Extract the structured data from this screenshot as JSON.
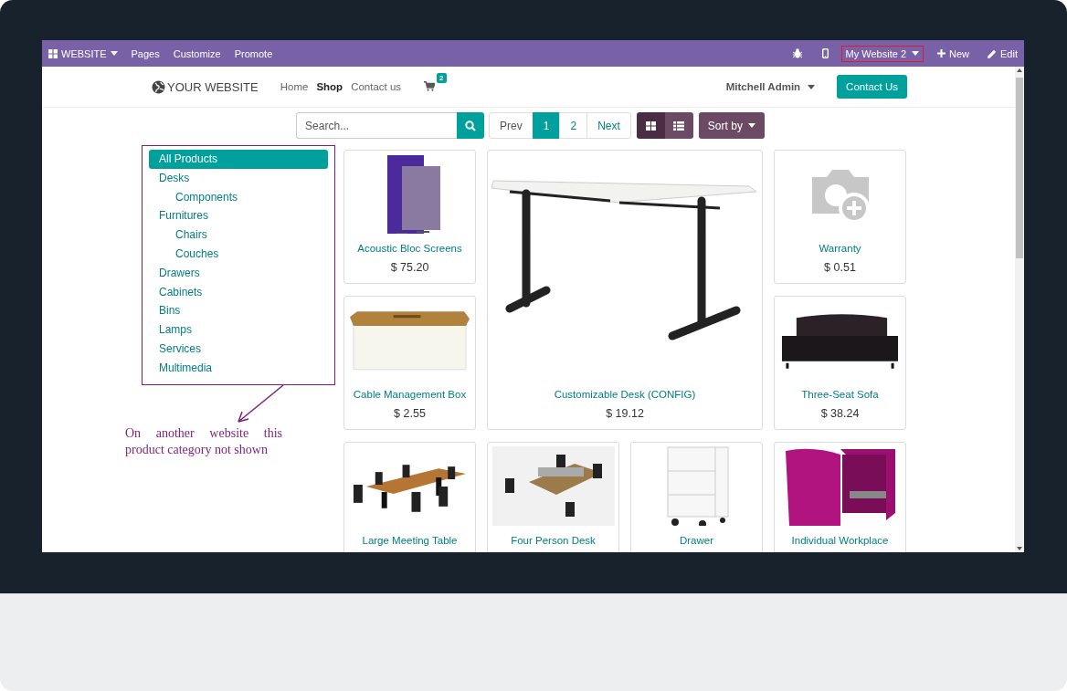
{
  "topbar": {
    "app_menu": "WEBSITE",
    "menu": [
      "Pages",
      "Customize",
      "Promote"
    ],
    "website_switcher": "My Website 2",
    "new": "New",
    "edit": "Edit"
  },
  "header": {
    "logo": "YOUR WEBSITE",
    "nav": [
      {
        "label": "Home",
        "selected": false
      },
      {
        "label": "Shop",
        "selected": true
      },
      {
        "label": "Contact us",
        "selected": false
      }
    ],
    "cart_count": "2",
    "user": "Mitchell Admin",
    "cta": "Contact Us"
  },
  "toolbar": {
    "search_placeholder": "Search...",
    "pager": [
      {
        "label": "Prev",
        "selected": false
      },
      {
        "label": "1",
        "selected": true
      },
      {
        "label": "2",
        "selected": false
      },
      {
        "label": "Next",
        "selected": false
      }
    ],
    "views": [
      {
        "kind": "grid",
        "selected": true
      },
      {
        "kind": "list",
        "selected": false
      }
    ],
    "sort": "Sort by"
  },
  "categories": [
    {
      "label": "All Products",
      "selected": true
    },
    {
      "label": "Desks",
      "selected": false,
      "children": [
        {
          "label": "Components",
          "selected": false
        }
      ]
    },
    {
      "label": "Furnitures",
      "selected": false,
      "children": [
        {
          "label": "Chairs",
          "selected": false
        },
        {
          "label": "Couches",
          "selected": false
        }
      ]
    },
    {
      "label": "Drawers",
      "selected": false
    },
    {
      "label": "Cabinets",
      "selected": false
    },
    {
      "label": "Bins",
      "selected": false
    },
    {
      "label": "Lamps",
      "selected": false
    },
    {
      "label": "Services",
      "selected": false
    },
    {
      "label": "Multimedia",
      "selected": false
    }
  ],
  "annotation": {
    "text": "On another website this product category not shown"
  },
  "products": [
    {
      "name": "Acoustic Bloc Screens",
      "price": "$ 75.20",
      "kind": "normal"
    },
    {
      "name": "Customizable Desk (CONFIG)",
      "price": "$ 19.12",
      "kind": "large"
    },
    {
      "name": "Warranty",
      "price": "$ 0.51",
      "kind": "normal"
    },
    {
      "name": "Cable Management Box",
      "price": "$ 2.55",
      "kind": "normal"
    },
    {
      "name": "Three-Seat Sofa",
      "price": "$ 38.24",
      "kind": "normal"
    },
    {
      "name": "Large Meeting Table",
      "kind": "normal"
    },
    {
      "name": "Four Person Desk",
      "kind": "normal"
    },
    {
      "name": "Drawer",
      "kind": "normal"
    },
    {
      "name": "Individual Workplace",
      "kind": "normal"
    }
  ]
}
